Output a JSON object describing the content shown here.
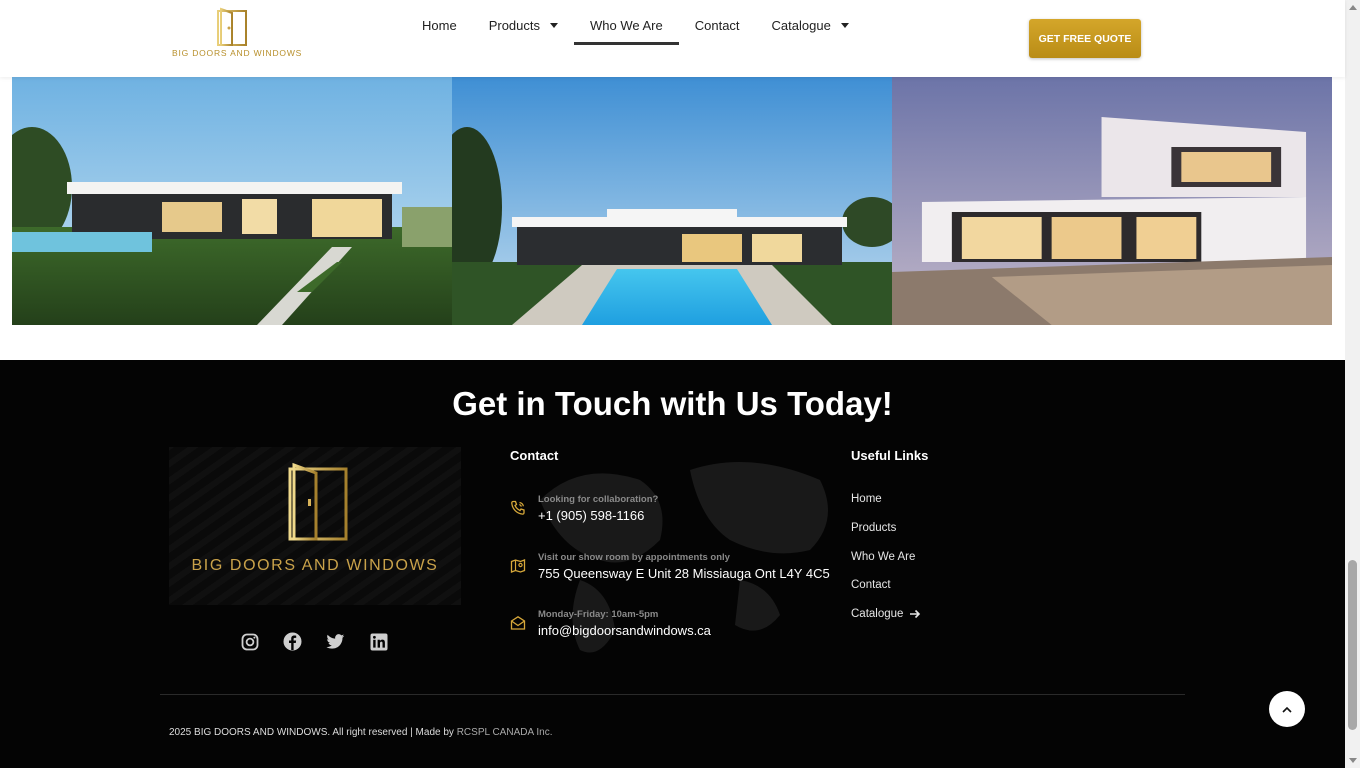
{
  "header": {
    "logo_text": "BIG DOORS AND WINDOWS",
    "nav": [
      {
        "label": "Home",
        "has_dropdown": false,
        "active": false
      },
      {
        "label": "Products",
        "has_dropdown": true,
        "active": false
      },
      {
        "label": "Who We Are",
        "has_dropdown": false,
        "active": true
      },
      {
        "label": "Contact",
        "has_dropdown": false,
        "active": false
      },
      {
        "label": "Catalogue",
        "has_dropdown": true,
        "active": false
      }
    ],
    "cta_label": "GET FREE QUOTE"
  },
  "gallery": {
    "images": [
      {
        "icon": "house-lawn-photo"
      },
      {
        "icon": "house-pool-photo"
      },
      {
        "icon": "house-dusk-photo"
      }
    ]
  },
  "footer": {
    "title": "Get in Touch with Us Today!",
    "logo_name": "BIG DOORS AND WINDOWS",
    "contact_title": "Contact",
    "contact_items": [
      {
        "icon": "phone-icon",
        "label": "Looking for collaboration?",
        "value": "+1 (905) 598-1166"
      },
      {
        "icon": "map-icon",
        "label": "Visit our show room by appointments only",
        "value": "755 Queensway E Unit 28 Missiauga Ont L4Y 4C5"
      },
      {
        "icon": "mail-icon",
        "label": "Monday-Friday: 10am-5pm",
        "value": "info@bigdoorsandwindows.ca"
      }
    ],
    "links_title": "Useful Links",
    "links": [
      "Home",
      "Products",
      "Who We Are",
      "Contact",
      "Catalogue"
    ],
    "socials": [
      "instagram-icon",
      "facebook-icon",
      "twitter-icon",
      "linkedin-icon"
    ],
    "copyright_prefix": "2025 BIG DOORS AND WINDOWS. All right reserved | Made by",
    "copyright_brand": "RCSPL CANADA Inc.",
    "back_to_top_icon": "chevron-up-icon"
  },
  "colors": {
    "gold": "#c9a24a",
    "button": "#c99a1e",
    "footer_bg": "#040404"
  }
}
